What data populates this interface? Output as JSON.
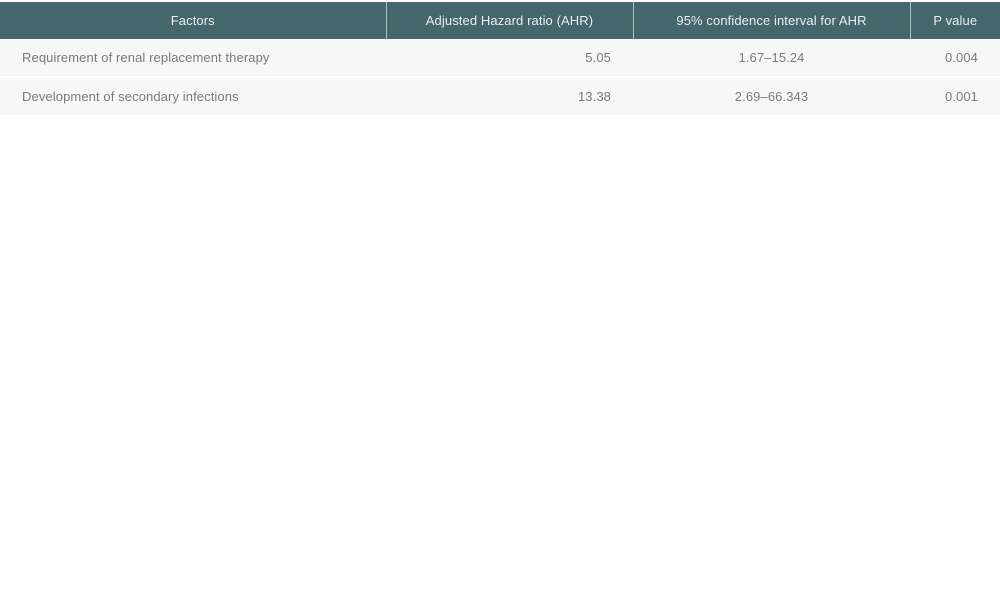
{
  "table": {
    "columns": [
      {
        "key": "factor",
        "label": "Factors"
      },
      {
        "key": "ahr",
        "label": "Adjusted Hazard ratio (AHR)"
      },
      {
        "key": "ci",
        "label": "95% confidence interval for AHR"
      },
      {
        "key": "p",
        "label": "P value"
      }
    ],
    "rows": [
      {
        "factor": "Requirement of renal replacement therapy",
        "ahr": "5.05",
        "ci": "1.67–15.24",
        "p": "0.004"
      },
      {
        "factor": "Development of secondary infections",
        "ahr": "13.38",
        "ci": "2.69–66.343",
        "p": "0.001"
      }
    ]
  },
  "colors": {
    "header_background": "#44666c",
    "header_text": "#e9eff0",
    "header_divider": "#a9c2c5",
    "row_background": "#f7f7f7",
    "row_text": "#7a7a7a",
    "page_background": "#ffffff"
  }
}
